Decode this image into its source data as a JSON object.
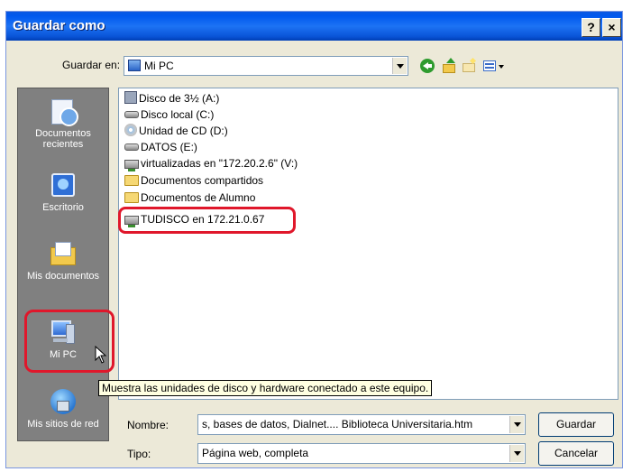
{
  "window": {
    "title": "Guardar como",
    "help_glyph": "?",
    "close_glyph": "×"
  },
  "toolbar": {
    "save_in_label": "Guardar en:",
    "save_in_value": "Mi PC",
    "icons": [
      "back-icon",
      "up-folder-icon",
      "new-folder-icon",
      "views-menu-icon"
    ]
  },
  "places": [
    {
      "label": "Documentos recientes",
      "icon": "recent-documents-icon"
    },
    {
      "label": "Escritorio",
      "icon": "desktop-icon"
    },
    {
      "label": "Mis documentos",
      "icon": "my-documents-icon"
    },
    {
      "label": "Mi PC",
      "icon": "my-computer-icon"
    },
    {
      "label": "Mis sitios de red",
      "icon": "network-places-icon"
    }
  ],
  "files": [
    {
      "label": "Disco de 3½ (A:)",
      "icon": "floppy-icon"
    },
    {
      "label": "Disco local (C:)",
      "icon": "hard-drive-icon"
    },
    {
      "label": "Unidad de CD (D:)",
      "icon": "cd-drive-icon"
    },
    {
      "label": "DATOS (E:)",
      "icon": "hard-drive-icon"
    },
    {
      "label": "virtualizadas en \"172.20.2.6\" (V:)",
      "icon": "network-drive-icon"
    },
    {
      "label": "Documentos compartidos",
      "icon": "folder-icon"
    },
    {
      "label": "Documentos de Alumno",
      "icon": "folder-icon"
    },
    {
      "label": "TUDISCO en 172.21.0.67",
      "icon": "network-drive-icon"
    }
  ],
  "tooltip": "Muestra las unidades de disco y hardware conectado a este equipo.",
  "form": {
    "name_label": "Nombre:",
    "name_value": "s, bases de datos, Dialnet.... Biblioteca Universitaria.htm",
    "type_label": "Tipo:",
    "type_value": "Página web, completa"
  },
  "buttons": {
    "save": "Guardar",
    "cancel": "Cancelar"
  },
  "colors": {
    "highlight_outline": "#e0172b",
    "title_bar": "#0058ee",
    "places_bar": "#808080",
    "tooltip_bg": "#ffffe1"
  }
}
